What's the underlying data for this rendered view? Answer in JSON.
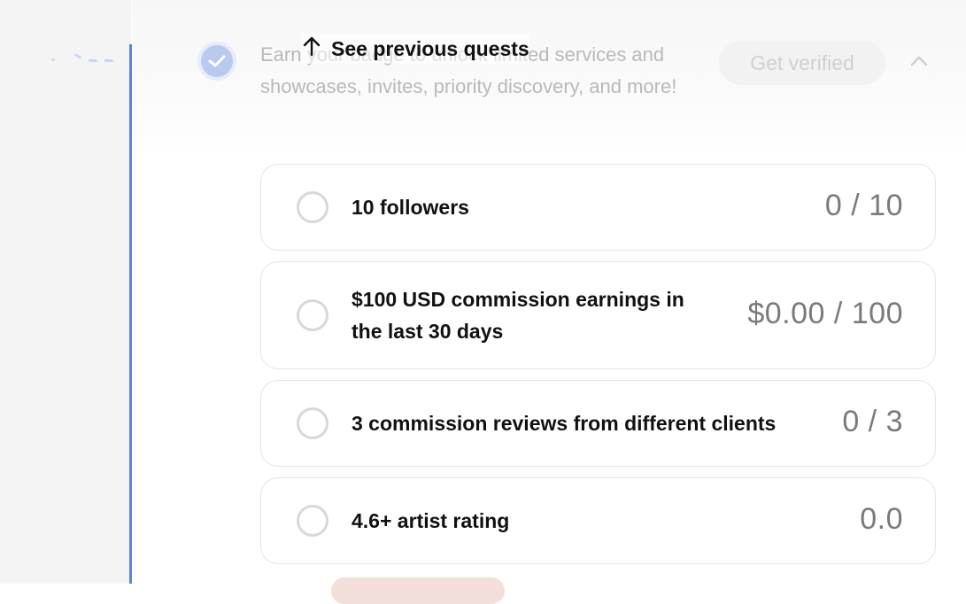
{
  "header": {
    "description": "Earn your badge to unlock limited services and showcases, invites, priority discovery, and more!",
    "see_previous_label": "See previous quests",
    "get_verified_label": "Get verified"
  },
  "quests": [
    {
      "label": "10 followers",
      "progress": "0 / 10"
    },
    {
      "label": "$100 USD commission earnings in the last 30 days",
      "progress": "$0.00 / 100"
    },
    {
      "label": "3 commission reviews from different clients",
      "progress": "0 / 3"
    },
    {
      "label": "4.6+ artist rating",
      "progress": "0.0"
    }
  ],
  "icons": {
    "verify": "check-badge-icon",
    "collapse": "chevron-up-icon",
    "see_previous": "arrow-up-icon",
    "quest_status": "empty-circle-icon"
  },
  "colors": {
    "accent_rail": "#5b86d6",
    "badge": "#b9caf1"
  }
}
